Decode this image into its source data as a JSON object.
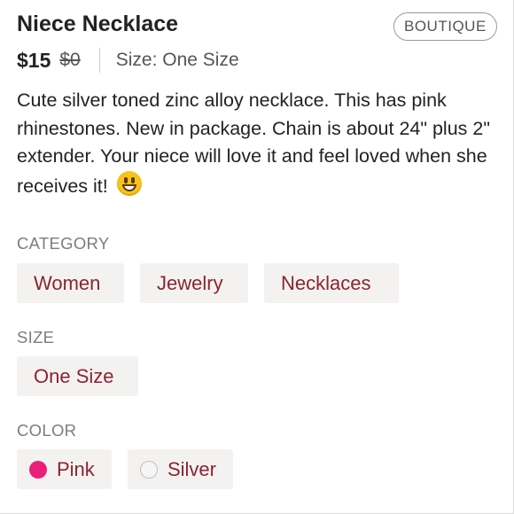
{
  "listing": {
    "title": "Niece Necklace",
    "badge": "BOUTIQUE",
    "price": "$15",
    "original_price": "$0",
    "size_text": "Size: One Size",
    "description": "Cute silver toned zinc alloy necklace. This has pink rhinestones. New in package. Chain is about 24\" plus 2\" extender. Your niece will love it and feel loved when she receives it!",
    "emoji_icon": "grinning-face-emoji"
  },
  "category": {
    "label": "CATEGORY",
    "items": [
      "Women",
      "Jewelry",
      "Necklaces"
    ]
  },
  "size": {
    "label": "SIZE",
    "items": [
      "One Size"
    ]
  },
  "color": {
    "label": "COLOR",
    "items": [
      {
        "name": "Pink",
        "swatch": "#ea1f78"
      },
      {
        "name": "Silver",
        "swatch": "#f5f5f5"
      }
    ]
  },
  "colors": {
    "chip_text": "#8a2432",
    "chip_bg": "#f4f2f0",
    "section_label": "#7d7d7d"
  }
}
